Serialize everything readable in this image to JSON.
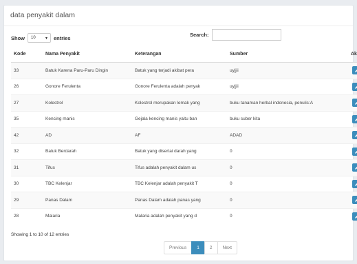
{
  "panel_title": "data penyakit dalam",
  "length": {
    "show": "Show",
    "value": "10",
    "entries": "entries"
  },
  "search": {
    "label": "Search:",
    "value": ""
  },
  "table": {
    "headers": [
      "Kode",
      "Nama Penyakit",
      "Keterangan",
      "Sumber",
      "Aksi"
    ],
    "rows": [
      [
        "33",
        "Batuk Karena Paru-Paru Dingin",
        "Batuk yang terjadi akibat pera",
        "uyjjii"
      ],
      [
        "26",
        "Gonore Ferulenta",
        "Gonore Ferulenta adalah penyak",
        "uyjjii"
      ],
      [
        "27",
        "Kolestrol",
        "Kolestrol merupakan lemak yang",
        "buku tanaman herbal indonesia, penulis:A"
      ],
      [
        "35",
        "Kencing manis",
        "Gejala kencing manis yaitu ban",
        "buku suber kita"
      ],
      [
        "42",
        "AD",
        "AF",
        "ADAD"
      ],
      [
        "32",
        "Batuk Berdarah",
        "Batuk yang disertai darah yang",
        "0"
      ],
      [
        "31",
        "Tifus",
        "Tifus adalah penyakit dalam us",
        "0"
      ],
      [
        "30",
        "TBC Kelenjar",
        "TBC Kelenjar adalah penyakit T",
        "0"
      ],
      [
        "29",
        "Panas Dalam",
        "Panas Dalam adalah panas yang",
        "0"
      ],
      [
        "28",
        "Malaria",
        "Malaria adalah penyakit yang d",
        "0"
      ]
    ]
  },
  "info": "Showing 1 to 10 of 12 entries",
  "pagination": {
    "previous": "Previous",
    "pages": [
      "1",
      "2"
    ],
    "active": "1",
    "next": "Next"
  },
  "colors": {
    "edit": "#3c8dbc",
    "delete": "#dd4b39"
  },
  "icons": {
    "edit": "pencil-icon",
    "delete": "trash-icon",
    "select": "chevron-down-icon"
  }
}
